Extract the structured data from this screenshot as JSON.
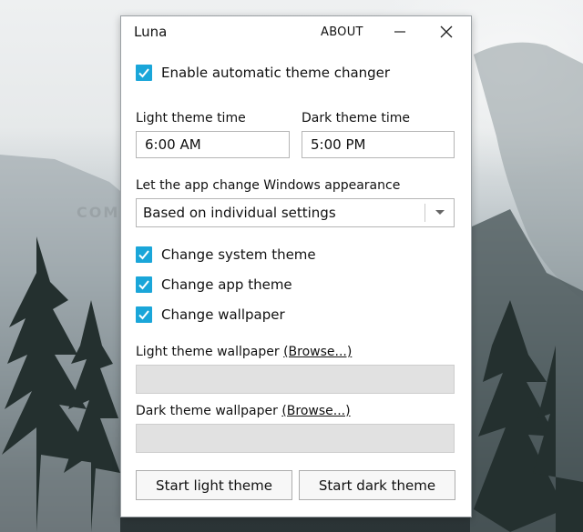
{
  "window": {
    "title": "Luna",
    "about_label": "ABOUT",
    "minimize_icon": "minimize-icon",
    "close_icon": "close-icon"
  },
  "auto_theme": {
    "checked": true,
    "label": "Enable automatic theme changer"
  },
  "times": {
    "light_label": "Light theme time",
    "light_value": "6:00 AM",
    "dark_label": "Dark theme time",
    "dark_value": "5:00 PM"
  },
  "appearance": {
    "label": "Let the app change Windows appearance",
    "selected": "Based on individual settings",
    "arrow_icon": "chevron-down-icon"
  },
  "options": [
    {
      "label": "Change system theme",
      "checked": true
    },
    {
      "label": "Change app theme",
      "checked": true
    },
    {
      "label": "Change wallpaper",
      "checked": true
    }
  ],
  "wallpapers": {
    "light_label": "Light theme wallpaper",
    "dark_label": "Dark theme wallpaper",
    "browse_label": "(Browse...)",
    "light_path": "",
    "dark_path": ""
  },
  "buttons": {
    "start_light": "Start light theme",
    "start_dark": "Start dark theme"
  },
  "watermark": "COMPUTERWD.COM",
  "colors": {
    "accent": "#1aa6d9",
    "window_bg": "#ffffff",
    "disabled_field": "#e1e1e1"
  }
}
